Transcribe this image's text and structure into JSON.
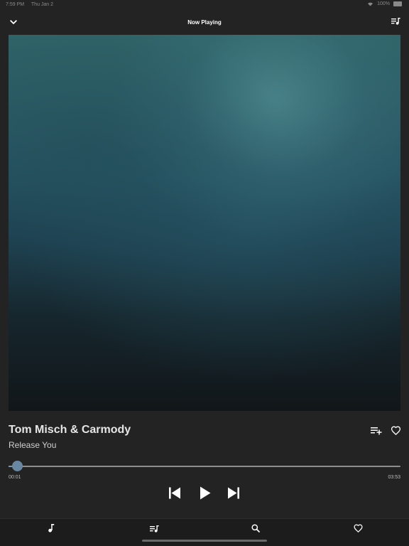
{
  "status_bar": {
    "time": "7:59 PM",
    "date": "Thu Jan 2",
    "battery": "100%"
  },
  "header": {
    "title": "Now Playing",
    "collapse_icon": "chevron-down-icon",
    "queue_icon": "queue-music-icon"
  },
  "track": {
    "artist": "Tom Misch & Carmody",
    "title": "Release You",
    "add_icon": "playlist-add-icon",
    "favorite_icon": "heart-outline-icon"
  },
  "playback": {
    "elapsed": "00:01",
    "duration": "03:53",
    "progress_fraction": 0.004,
    "previous_icon": "skip-previous-icon",
    "play_icon": "play-icon",
    "next_icon": "skip-next-icon"
  },
  "tabs": [
    {
      "icon": "music-note-icon"
    },
    {
      "icon": "queue-music-icon"
    },
    {
      "icon": "search-icon"
    },
    {
      "icon": "heart-outline-icon"
    }
  ],
  "colors": {
    "background": "#232323",
    "accent": "#6787a3"
  }
}
